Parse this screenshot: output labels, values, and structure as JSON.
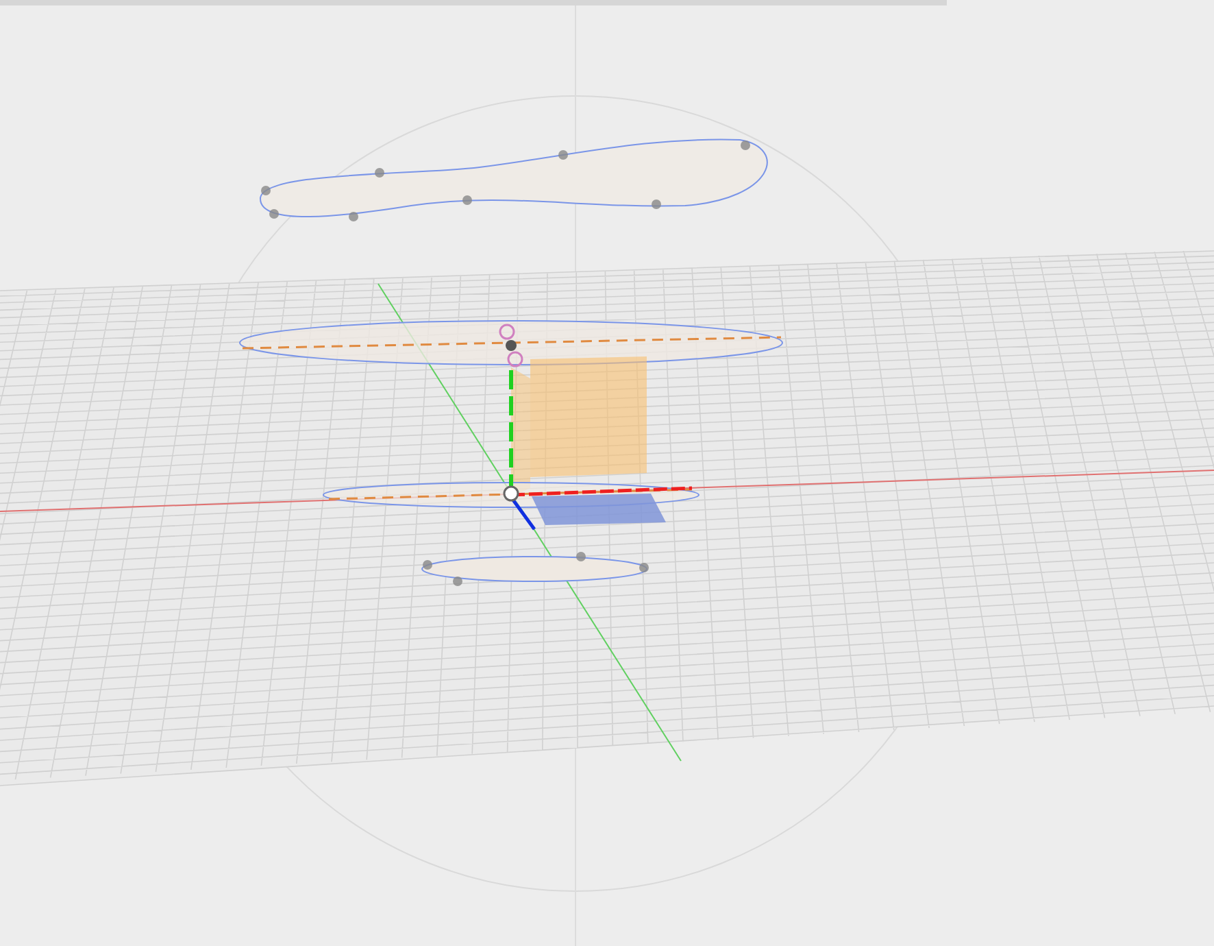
{
  "progress": {
    "level": 0.78
  },
  "viewport": {
    "kind": "perspective"
  }
}
